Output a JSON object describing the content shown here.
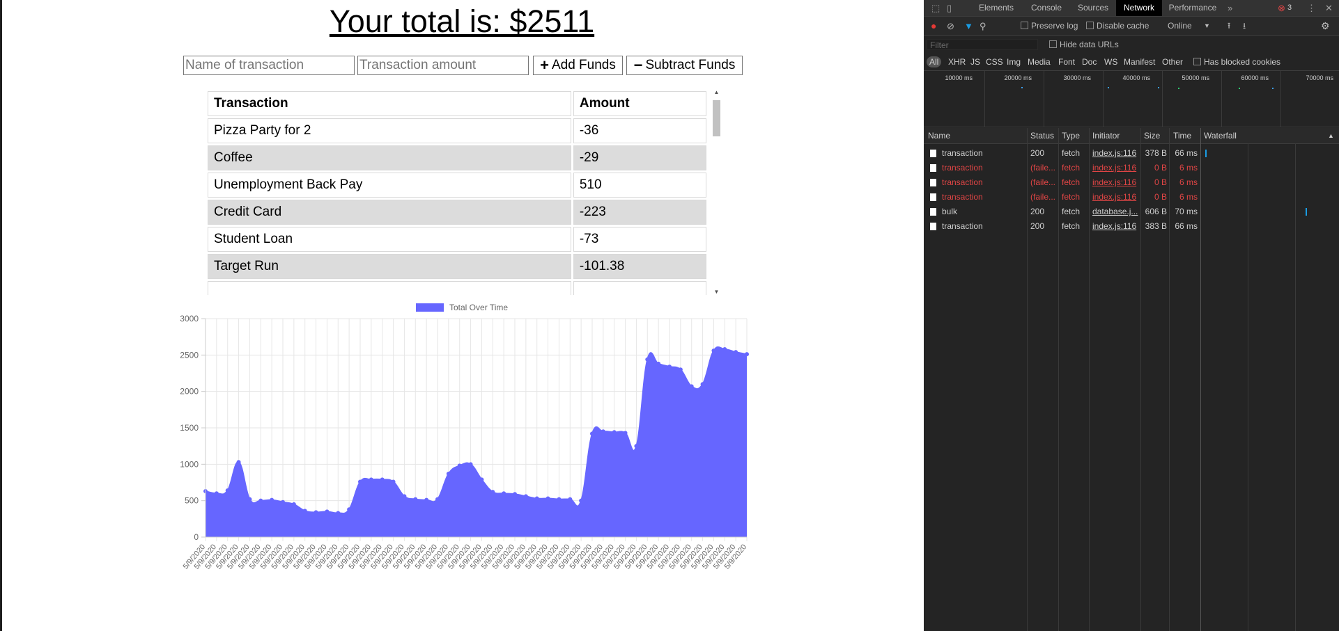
{
  "app": {
    "total_label": "Your total is: $2511",
    "name_placeholder": "Name of transaction",
    "amount_placeholder": "Transaction amount",
    "add_label": "Add Funds",
    "subtract_label": "Subtract Funds",
    "table": {
      "headers": [
        "Transaction",
        "Amount"
      ],
      "rows": [
        {
          "name": "Pizza Party for 2",
          "amount": "-36"
        },
        {
          "name": "Coffee",
          "amount": "-29"
        },
        {
          "name": "Unemployment Back Pay",
          "amount": "510"
        },
        {
          "name": "Credit Card",
          "amount": "-223"
        },
        {
          "name": "Student Loan",
          "amount": "-73"
        },
        {
          "name": "Target Run",
          "amount": "-101.38"
        }
      ]
    }
  },
  "chart_data": {
    "type": "area",
    "legend": "Total Over Time",
    "legend_position": "top",
    "color": "#6666ff",
    "x_label_each": "5/9/2020",
    "ylim": [
      0,
      3000
    ],
    "yticks": [
      0,
      500,
      1000,
      1500,
      2000,
      2500,
      3000
    ],
    "grid": true,
    "values": [
      630,
      600,
      640,
      1030,
      520,
      500,
      510,
      480,
      450,
      360,
      340,
      350,
      330,
      380,
      760,
      790,
      790,
      760,
      560,
      520,
      510,
      520,
      870,
      980,
      1000,
      790,
      620,
      600,
      590,
      560,
      530,
      530,
      520,
      520,
      500,
      1420,
      1450,
      1440,
      1430,
      1250,
      2440,
      2380,
      2340,
      2300,
      2070,
      2100,
      2560,
      2580,
      2540,
      2511
    ]
  },
  "devtools": {
    "tabs": [
      "Elements",
      "Console",
      "Sources",
      "Network",
      "Performance"
    ],
    "active_tab": "Network",
    "more_tabs": "»",
    "error_count": "3",
    "toolbar": {
      "preserve_log": "Preserve log",
      "disable_cache": "Disable cache",
      "throttling": "Online"
    },
    "filter_placeholder": "Filter",
    "hide_data_urls": "Hide data URLs",
    "type_filters": [
      "All",
      "XHR",
      "JS",
      "CSS",
      "Img",
      "Media",
      "Font",
      "Doc",
      "WS",
      "Manifest",
      "Other"
    ],
    "has_blocked_cookies": "Has blocked cookies",
    "overview_ticks": [
      "10000 ms",
      "20000 ms",
      "30000 ms",
      "40000 ms",
      "50000 ms",
      "60000 ms",
      "70000 ms"
    ],
    "columns": [
      "Name",
      "Status",
      "Type",
      "Initiator",
      "Size",
      "Time",
      "Waterfall"
    ],
    "requests": [
      {
        "name": "transaction",
        "status": "200",
        "type": "fetch",
        "initiator": "index.js:116",
        "size": "378 B",
        "time": "66 ms",
        "failed": false
      },
      {
        "name": "transaction",
        "status": "(faile...",
        "type": "fetch",
        "initiator": "index.js:116",
        "size": "0 B",
        "time": "6 ms",
        "failed": true
      },
      {
        "name": "transaction",
        "status": "(faile...",
        "type": "fetch",
        "initiator": "index.js:116",
        "size": "0 B",
        "time": "6 ms",
        "failed": true
      },
      {
        "name": "transaction",
        "status": "(faile...",
        "type": "fetch",
        "initiator": "index.js:116",
        "size": "0 B",
        "time": "6 ms",
        "failed": true
      },
      {
        "name": "bulk",
        "status": "200",
        "type": "fetch",
        "initiator": "database.j...",
        "size": "606 B",
        "time": "70 ms",
        "failed": false
      },
      {
        "name": "transaction",
        "status": "200",
        "type": "fetch",
        "initiator": "index.js:116",
        "size": "383 B",
        "time": "66 ms",
        "failed": false
      }
    ]
  }
}
